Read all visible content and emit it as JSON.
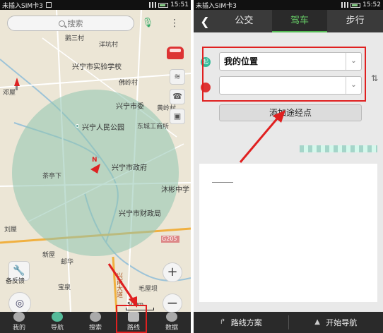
{
  "left": {
    "status": {
      "carrier": "未插入SIM卡3",
      "time": "15:51"
    },
    "search": {
      "placeholder": "搜索"
    },
    "map_labels": {
      "l1": "鹅三村",
      "l2": "洋坑村",
      "l3": "兴宁市实验学校",
      "l4": "佛岭村",
      "l5": "兴宁市委",
      "l6": "黄岭村",
      "l7": "兴宁人民公园",
      "l8": "东城工商所",
      "l9": "兴宁市政府",
      "l10": "茶亭下",
      "l11": "沐彬中学",
      "l12": "兴宁市财政局",
      "l13": "邓屋",
      "l14": "刘屋",
      "l15": "新屋",
      "l16": "宝泉",
      "l17": "邮华",
      "l18": "毛屋坝",
      "l19": "兴南大道",
      "road": "G205",
      "compass_n": "N"
    },
    "wrench_label": "备反馈",
    "scale": "500m",
    "tabs": [
      {
        "label": "我的"
      },
      {
        "label": "导航"
      },
      {
        "label": "搜索"
      },
      {
        "label": "路线"
      },
      {
        "label": "数据"
      }
    ]
  },
  "right": {
    "status": {
      "carrier": "未插入SIM卡3",
      "time": "15:52"
    },
    "tabs": [
      {
        "label": "公交"
      },
      {
        "label": "驾车"
      },
      {
        "label": "步行"
      }
    ],
    "origin": {
      "value": "我的位置",
      "badge": "起"
    },
    "destination": {
      "value": ""
    },
    "add_waypoint": "添加途经点",
    "bottom": {
      "route_plan": "路线方案",
      "start_nav": "开始导航"
    }
  },
  "colors": {
    "highlight": "#e02020",
    "accent": "#55bb55",
    "map_circle": "#8fc4b0"
  }
}
